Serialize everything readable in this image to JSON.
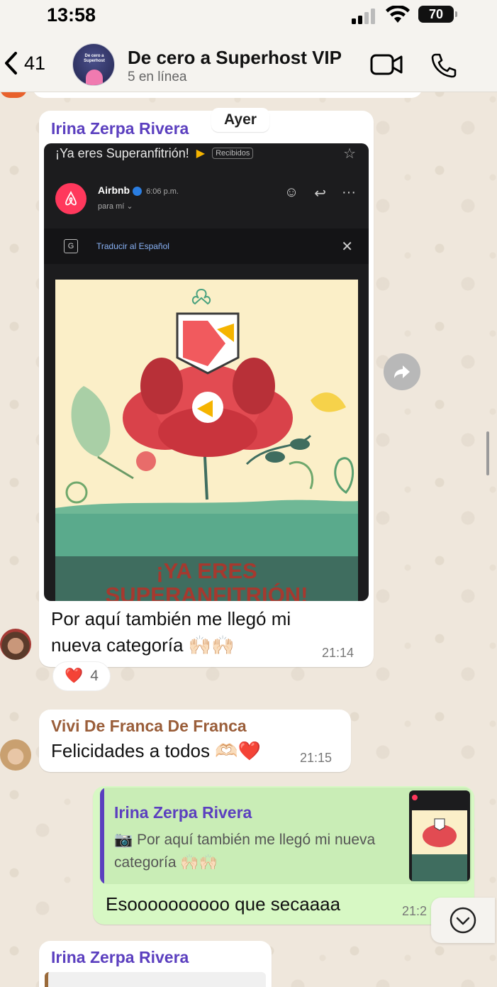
{
  "status_bar": {
    "time": "13:58",
    "battery": "70"
  },
  "header": {
    "back_count": "41",
    "group_name": "De cero a Superhost VIP",
    "group_status": "5 en línea",
    "avatar_text": "De cero a Superhost"
  },
  "date_chip": "Ayer",
  "messages": [
    {
      "sender": "Irina Zerpa Rivera",
      "sender_color": "#5b3fbf",
      "email": {
        "subject": "¡Ya eres Superanfitrión!",
        "tag": "Recibidos",
        "from": "Airbnb",
        "time": "6:06 p.m.",
        "to": "para mí ⌄",
        "translate": "Traducir al Español",
        "hero_title": "¡YA ERES SUPERANFITRIÓN!"
      },
      "text_line1": "Por aquí también me llegó mi",
      "text_line2": "nueva categoría 🙌🏻🙌🏻",
      "time": "21:14",
      "reaction_emoji": "❤️",
      "reaction_count": "4"
    },
    {
      "sender": "Vivi De Franca De Franca",
      "sender_color": "#9a5e3a",
      "text": "Felicidades a todos 🫶🏻❤️",
      "time": "21:15"
    },
    {
      "quote_sender": "Irina Zerpa Rivera",
      "quote_text": "Por aquí también me llegó mi nueva categoría 🙌🏻🙌🏻",
      "text": "Esoooooooooo que secaaaa",
      "time": "21:2"
    },
    {
      "sender": "Irina Zerpa Rivera",
      "sender_color": "#5b3fbf"
    }
  ]
}
